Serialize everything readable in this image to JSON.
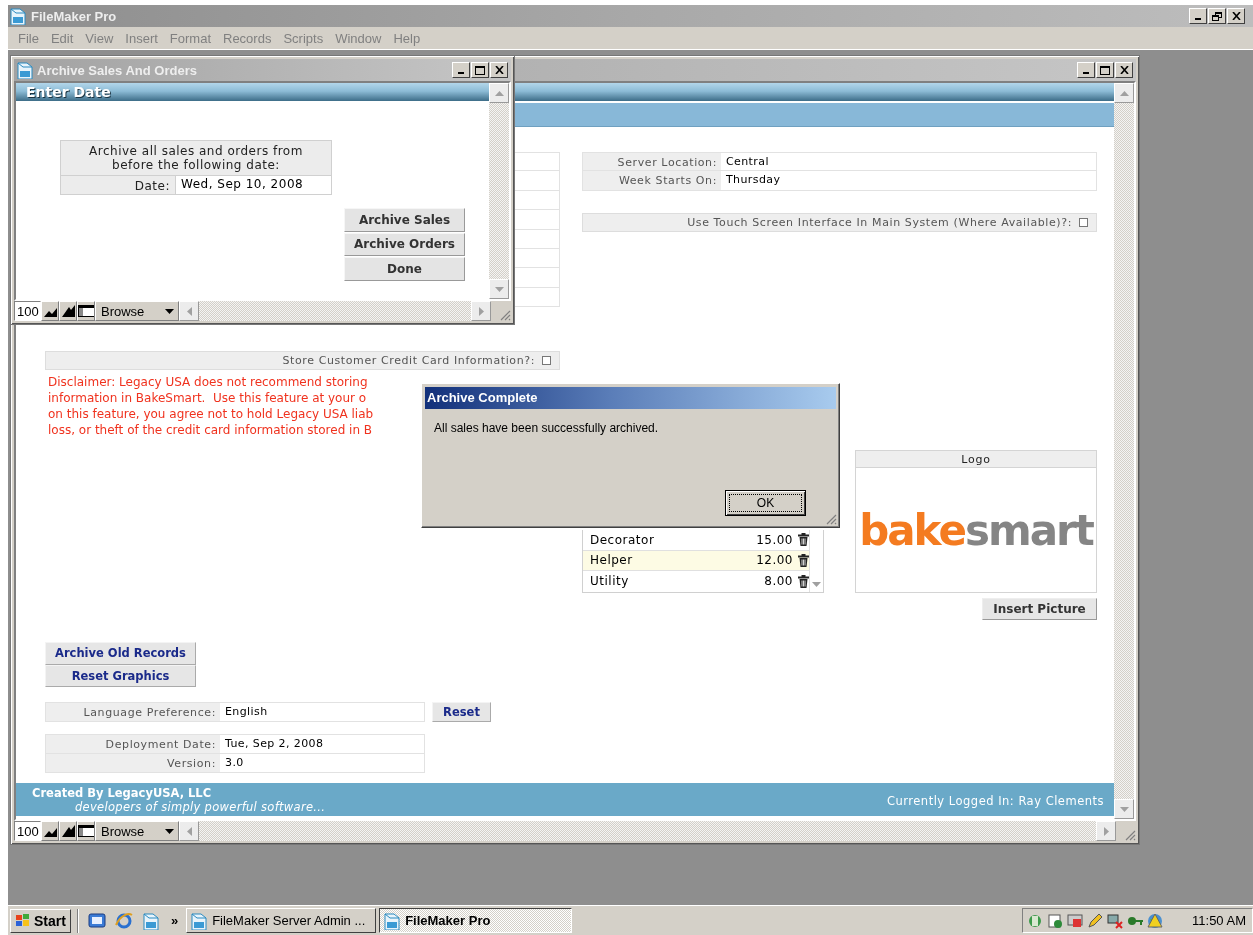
{
  "app": {
    "title": "FileMaker Pro",
    "menu": [
      "File",
      "Edit",
      "View",
      "Insert",
      "Format",
      "Records",
      "Scripts",
      "Window",
      "Help"
    ]
  },
  "main_window": {
    "settings": [
      {
        "label": "Server Location:",
        "value": "Central"
      },
      {
        "label": "Week Starts On:",
        "value": "Thursday"
      }
    ],
    "touch_option": {
      "label": "Use Touch Screen Interface In Main System (Where Available)?:",
      "checked": false
    },
    "credit_card_option": {
      "label": "Store Customer Credit Card Information?:",
      "checked": false
    },
    "disclaimer_lines": [
      "Disclaimer: Legacy USA does not recommend storing",
      "information in BakeSmart.  Use this feature at your o",
      "on this feature, you agree not to hold Legacy USA liab",
      "loss, or theft of the credit card information stored in B"
    ],
    "wage_rows": [
      {
        "name": "Decorator",
        "rate": "15.00",
        "selected": false
      },
      {
        "name": "Helper",
        "rate": "12.00",
        "selected": true
      },
      {
        "name": "Utility",
        "rate": "8.00",
        "selected": false
      }
    ],
    "logo": {
      "label": "Logo",
      "parts": [
        {
          "text": "bake",
          "color": "#f47b20"
        },
        {
          "text": "smart",
          "color": "#858585"
        }
      ]
    },
    "insert_picture_button": "Insert Picture",
    "buttons": [
      "Archive Old Records",
      "Reset Graphics"
    ],
    "language": {
      "label": "Language Preference:",
      "value": "English",
      "button": "Reset"
    },
    "info": [
      {
        "label": "Deployment Date:",
        "value": "Tue, Sep 2, 2008"
      },
      {
        "label": "Version:",
        "value": "3.0"
      }
    ],
    "footer": {
      "credit": "Created By LegacyUSA, LLC",
      "tagline": "developers of simply powerful software...",
      "login": "Currently Logged In: Ray Clements"
    },
    "status_bar": {
      "zoom": "100",
      "mode": "Browse"
    }
  },
  "archive_window": {
    "title": "Archive Sales And Orders",
    "header": "Enter Date",
    "prompt": "Archive all sales and orders from before the following date:",
    "date_label": "Date:",
    "date_value": "Wed, Sep 10, 2008",
    "buttons": [
      "Archive Sales",
      "Archive Orders",
      "Done"
    ],
    "status_bar": {
      "zoom": "100",
      "mode": "Browse"
    }
  },
  "dialog": {
    "title": "Archive Complete",
    "message": "All sales have been successfully archived.",
    "button": "OK"
  },
  "taskbar": {
    "start": "Start",
    "more": "»",
    "tasks": [
      {
        "label": "FileMaker Server Admin ...",
        "selected": false
      },
      {
        "label": "FileMaker Pro",
        "selected": true
      }
    ],
    "clock": "11:50 AM"
  }
}
